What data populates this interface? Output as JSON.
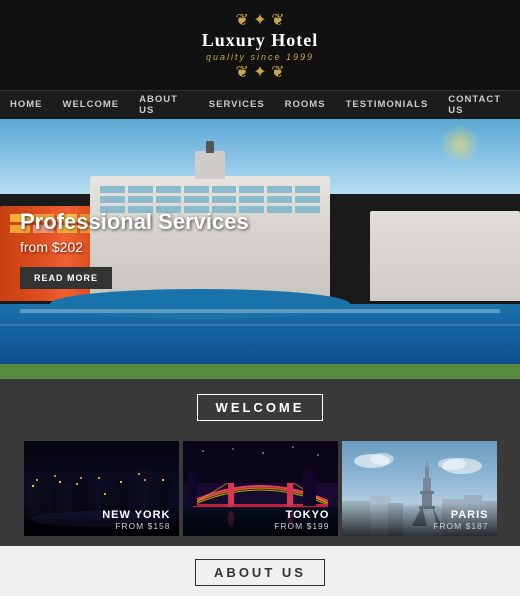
{
  "header": {
    "ornament_top": "❦ ✦ ❦",
    "logo_title": "Luxury Hotel",
    "logo_subtitle": "quality since 1999",
    "ornament_bottom": "❦ ✦ ❦"
  },
  "nav": {
    "items": [
      {
        "label": "HOME",
        "id": "home"
      },
      {
        "label": "WELCOME",
        "id": "welcome"
      },
      {
        "label": "ABOUT US",
        "id": "about-us"
      },
      {
        "label": "SERVICES",
        "id": "services"
      },
      {
        "label": "ROOMS",
        "id": "rooms"
      },
      {
        "label": "TESTIMONIALS",
        "id": "testimonials"
      },
      {
        "label": "CONTACT US",
        "id": "contact-us"
      }
    ]
  },
  "hero": {
    "title": "Professional Services",
    "price": "from $202",
    "button_label": "READ MORE"
  },
  "welcome": {
    "section_title": "WELCOME",
    "cards": [
      {
        "city": "NEW YORK",
        "price": "FROM $158",
        "id": "new-york"
      },
      {
        "city": "TOKYO",
        "price": "FROM $199",
        "id": "tokyo"
      },
      {
        "city": "PARIS",
        "price": "FROM $187",
        "id": "paris"
      }
    ]
  },
  "about": {
    "section_title": "ABOUT US"
  }
}
